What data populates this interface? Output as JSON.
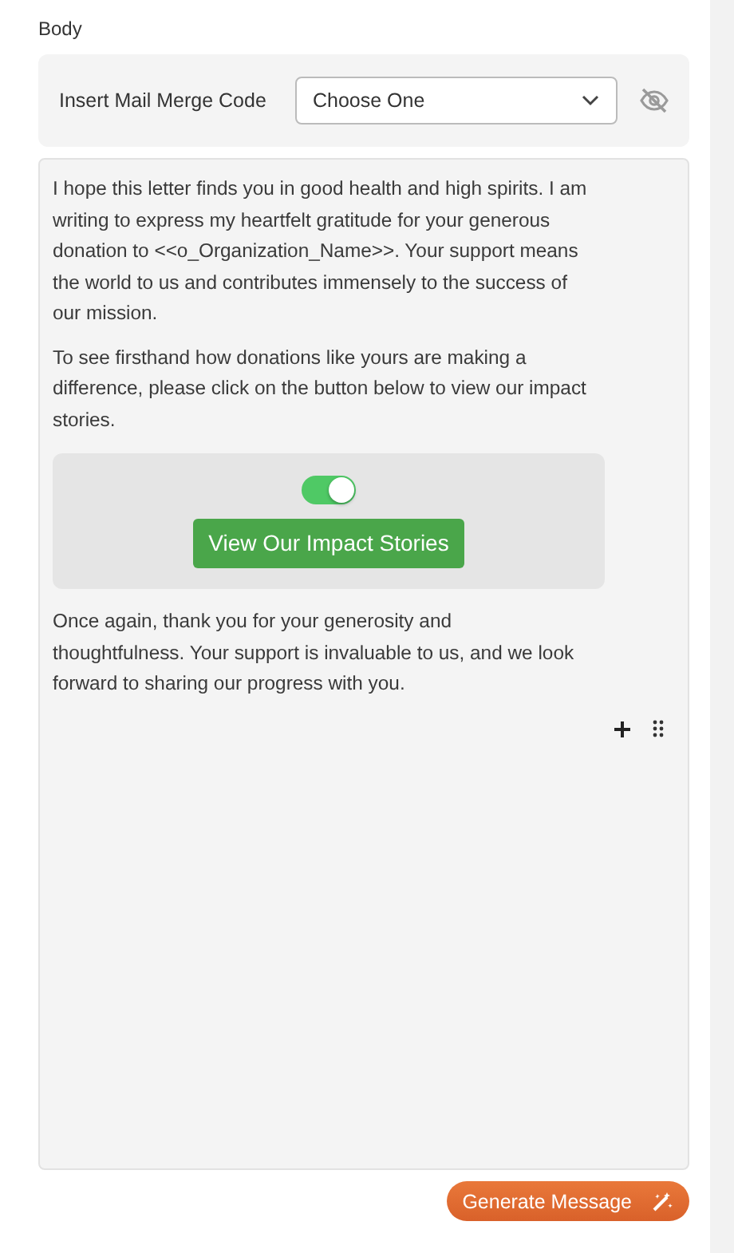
{
  "section_label": "Body",
  "merge_bar": {
    "label": "Insert Mail Merge Code",
    "dropdown": {
      "value": "Choose One"
    },
    "visibility_hidden": true
  },
  "editor": {
    "paragraphs_before": [
      "I hope this letter finds you in good health and high spirits. I am writing to express my heartfelt gratitude for your generous donation to <<o_Organization_Name>>. Your support means the world to us and contributes immensely to the success of our mission.",
      "To see firsthand how donations like yours are making a difference, please click on the button below to view our impact stories."
    ],
    "button_block": {
      "toggle_on": true,
      "button_label": "View Our Impact Stories"
    },
    "paragraphs_after": [
      "Once again, thank you for your generosity and thoughtfulness. Your support is invaluable to us, and we look forward to sharing our progress with you."
    ]
  },
  "generate_button": {
    "label": "Generate Message"
  }
}
